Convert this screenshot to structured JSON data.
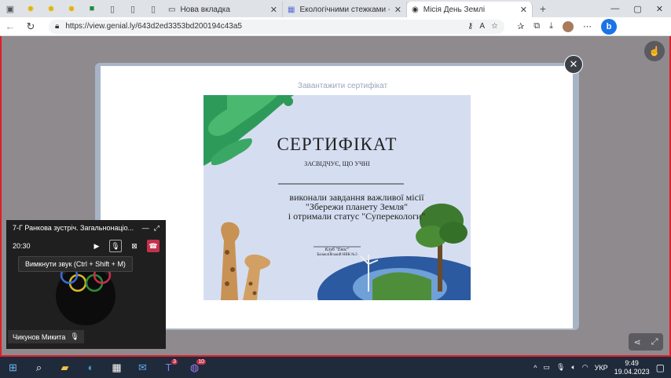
{
  "tabs": [
    {
      "title": "Нова вкладка",
      "icon": "page-icon"
    },
    {
      "title": "Екологічними стежками - Квес",
      "icon": "grid-icon"
    },
    {
      "title": "Місія День Землі",
      "icon": "chrome-icon",
      "active": true
    }
  ],
  "url": "https://view.genial.ly/643d2ed3353bd200194c43a5",
  "modal": {
    "download_label": "Завантажити сертифікат"
  },
  "certificate": {
    "title": "СЕРТИФІКАТ",
    "subtitle": "ЗАСВІДЧУЄ, ЩО УЧНІ",
    "line1": "виконали завдання важливої місії",
    "line2": "\"Збережи планету Земля\"",
    "line3": "і отримали статус \"Суперекологи\"",
    "club": "Клуб \"Екос\"",
    "school": "Балаклійський НВК №3"
  },
  "call": {
    "title": "7-Г Ранкова зустріч. Загальнонаціо...",
    "time": "20:30",
    "tooltip": "Вимкнути звук (Ctrl + Shift + M)",
    "participant": "Чикунов Микита"
  },
  "taskbar": {
    "lang": "УКР",
    "time": "9:49",
    "date": "19.04.2023",
    "teams_badge": "3",
    "viber_badge": "10"
  }
}
